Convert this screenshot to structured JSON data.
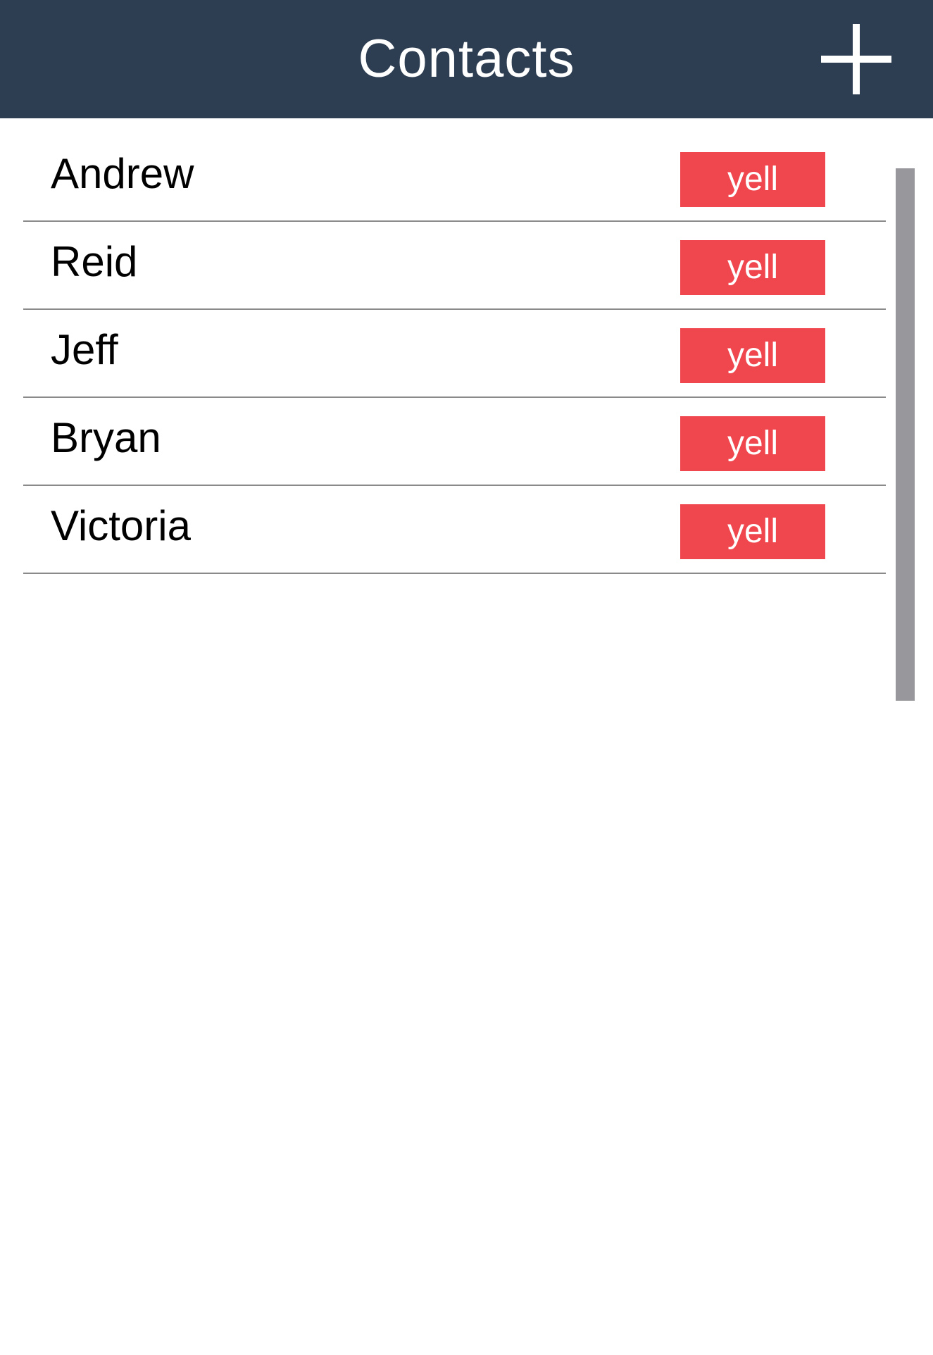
{
  "header": {
    "title": "Contacts",
    "add_icon": "plus-icon"
  },
  "contacts": [
    {
      "name": "Andrew",
      "action_label": "yell"
    },
    {
      "name": "Reid",
      "action_label": "yell"
    },
    {
      "name": "Jeff",
      "action_label": "yell"
    },
    {
      "name": "Bryan",
      "action_label": "yell"
    },
    {
      "name": "Victoria",
      "action_label": "yell"
    }
  ],
  "colors": {
    "header_background": "#2e3e52",
    "yell_button": "#f0464e",
    "divider": "#8a8a8a",
    "scrollbar": "#98989c"
  }
}
